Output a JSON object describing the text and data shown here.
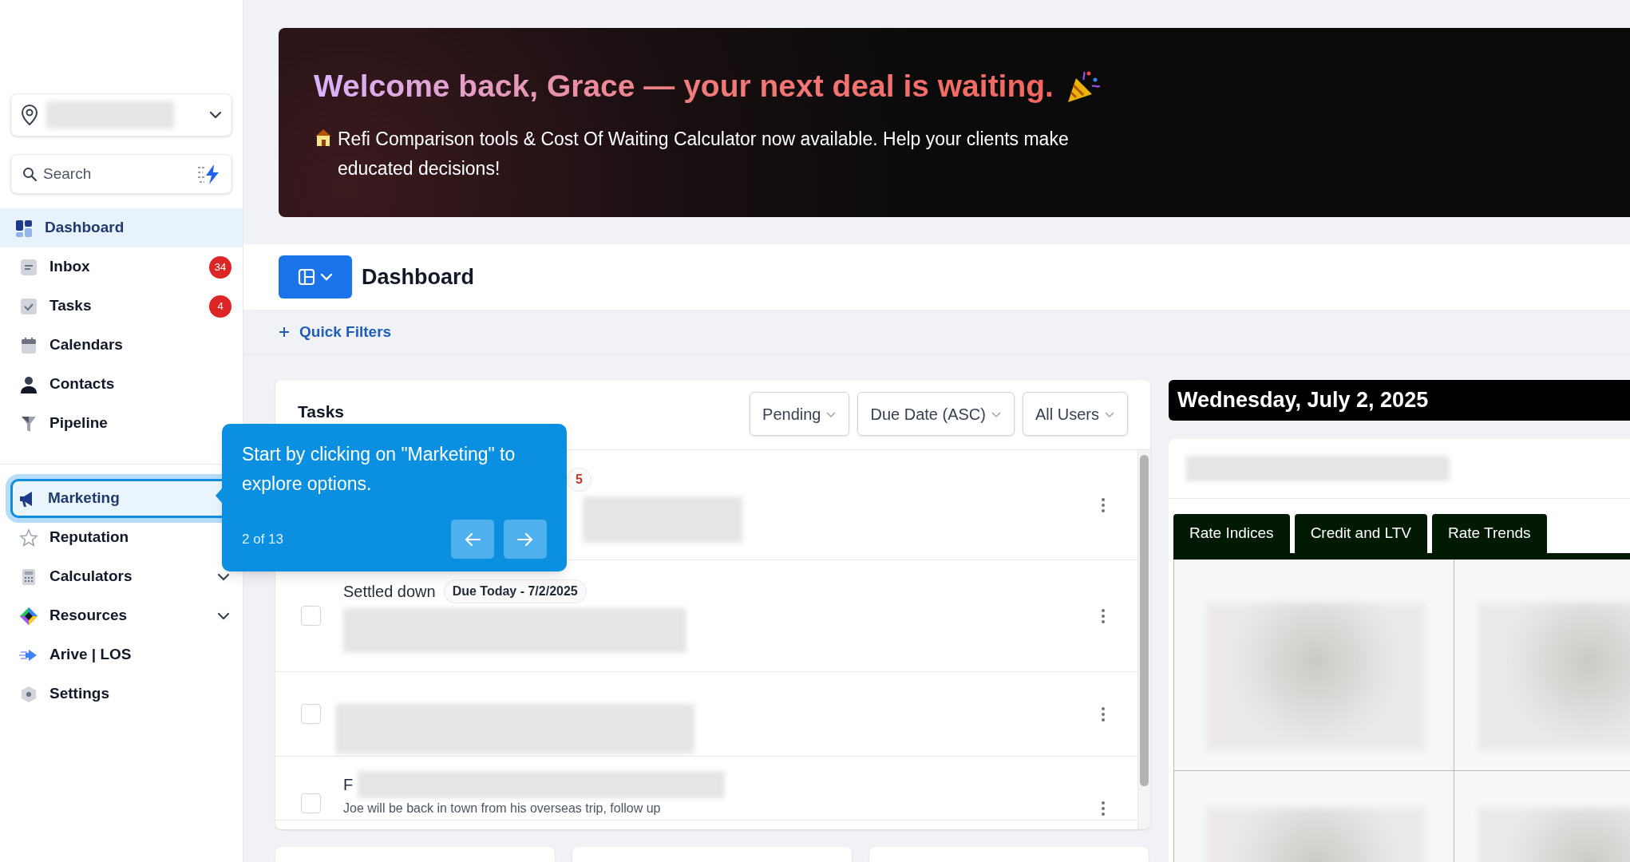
{
  "sidebar": {
    "location_selector": {
      "expanded": false
    },
    "search": {
      "placeholder": "Search"
    },
    "items": [
      {
        "label": "Dashboard",
        "selected": true,
        "highlighted": false,
        "has_submenu": false
      },
      {
        "label": "Inbox",
        "selected": false,
        "highlighted": false,
        "badge": "34",
        "has_submenu": false
      },
      {
        "label": "Tasks",
        "selected": false,
        "highlighted": false,
        "badge": "4",
        "has_submenu": false
      },
      {
        "label": "Calendars",
        "selected": false,
        "highlighted": false,
        "has_submenu": false
      },
      {
        "label": "Contacts",
        "selected": false,
        "highlighted": false,
        "has_submenu": false
      },
      {
        "label": "Pipeline",
        "selected": false,
        "highlighted": false,
        "has_submenu": false
      },
      {
        "label": "Marketing",
        "selected": false,
        "highlighted": true,
        "has_submenu": false
      },
      {
        "label": "Reputation",
        "selected": false,
        "highlighted": false,
        "has_submenu": false
      },
      {
        "label": "Calculators",
        "selected": false,
        "highlighted": false,
        "has_submenu": true
      },
      {
        "label": "Resources",
        "selected": false,
        "highlighted": false,
        "has_submenu": true
      },
      {
        "label": "Arive | LOS",
        "selected": false,
        "highlighted": false,
        "has_submenu": false
      },
      {
        "label": "Settings",
        "selected": false,
        "highlighted": false,
        "has_submenu": false
      }
    ]
  },
  "banner": {
    "title": "Welcome back, Grace — your next deal is waiting.",
    "message": "Refi Comparison tools & Cost Of Waiting Calculator now available. Help your clients make educated decisions!"
  },
  "page_header": {
    "title": "Dashboard",
    "quick_filters": "Quick Filters"
  },
  "tasks": {
    "title": "Tasks",
    "filters": [
      "Pending",
      "Due Date (ASC)",
      "All Users"
    ],
    "rows": [
      {
        "badge": {
          "text": "5",
          "color": "#c0392b"
        }
      },
      {
        "title": "Settled down",
        "badge": {
          "text": "Due Today - 7/2/2025",
          "color": "#1f2937"
        },
        "checked": false
      },
      {
        "checked": false
      },
      {
        "title": "F",
        "description": "Joe will be back in town from his overseas trip, follow up",
        "checked": false
      }
    ]
  },
  "date_bar": "Wednesday, July 2, 2025",
  "rates": {
    "tabs": [
      {
        "label": "Rate Indices",
        "selected": false
      },
      {
        "label": "Credit and LTV",
        "selected": false
      },
      {
        "label": "Rate Trends",
        "selected": false
      }
    ]
  },
  "tour_tooltip": {
    "text": "Start by clicking on \"Marketing\" to explore options.",
    "step": "2 of 13"
  }
}
